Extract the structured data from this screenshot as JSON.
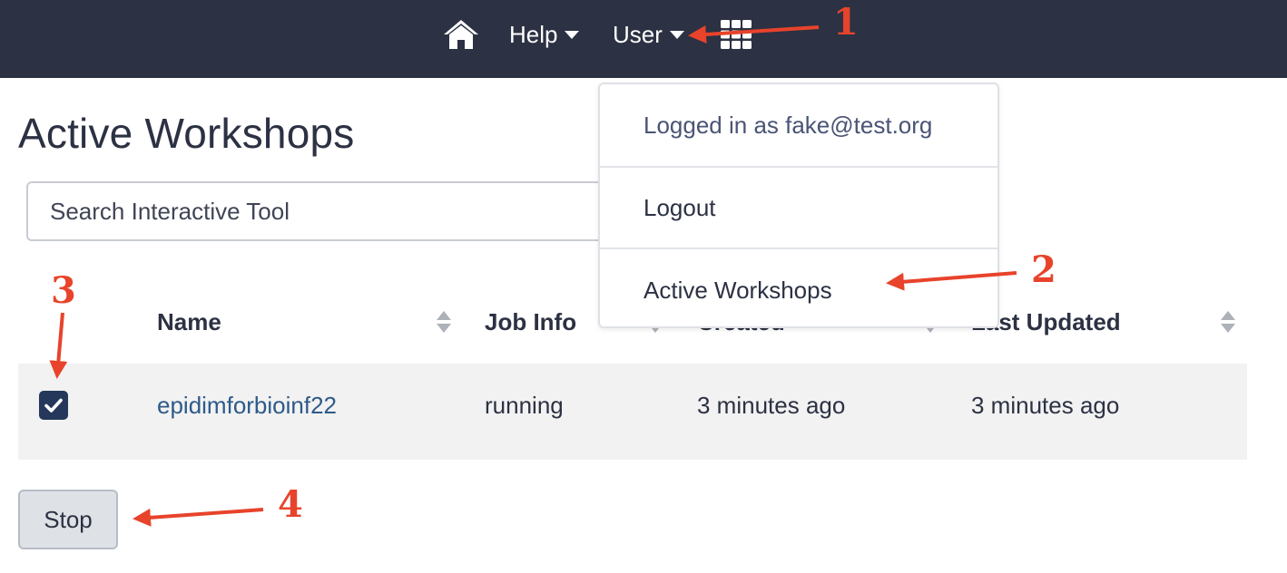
{
  "navbar": {
    "home_icon": "home-icon",
    "help_label": "Help",
    "user_label": "User",
    "apps_icon": "grid-icon",
    "background": "#2c3143"
  },
  "page": {
    "title": "Active Workshops"
  },
  "search": {
    "placeholder": "Search Interactive Tool",
    "value": ""
  },
  "table": {
    "columns": [
      {
        "label": "Name"
      },
      {
        "label": "Job Info"
      },
      {
        "label": "Created"
      },
      {
        "label": "Last Updated"
      }
    ],
    "rows": [
      {
        "selected": true,
        "name": "epidimforbioinf22",
        "job_info": "running",
        "created": "3 minutes ago",
        "last_updated": "3 minutes ago"
      }
    ]
  },
  "actions": {
    "stop_label": "Stop"
  },
  "user_menu": {
    "header": "Logged in as fake@test.org",
    "items": [
      {
        "label": "Logout"
      },
      {
        "label": "Active Workshops"
      }
    ]
  },
  "annotations": {
    "color": "#e8432b",
    "labels": [
      "1",
      "2",
      "3",
      "4"
    ]
  }
}
